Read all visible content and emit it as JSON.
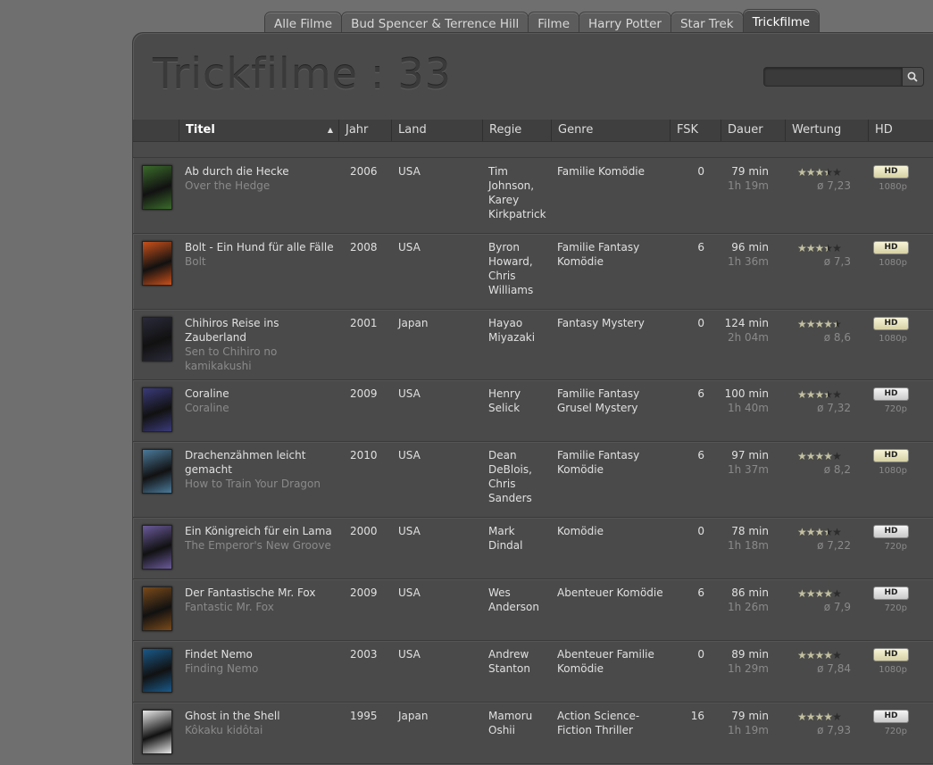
{
  "tabs": [
    {
      "label": "Alle Filme",
      "active": false
    },
    {
      "label": "Bud Spencer & Terrence Hill",
      "active": false
    },
    {
      "label": "Filme",
      "active": false
    },
    {
      "label": "Harry Potter",
      "active": false
    },
    {
      "label": "Star Trek",
      "active": false
    },
    {
      "label": "Trickfilme",
      "active": true
    }
  ],
  "page": {
    "title": "Trickfilme",
    "separator": ":",
    "count": "33"
  },
  "search": {
    "placeholder": "",
    "value": ""
  },
  "columns": [
    {
      "key": "poster",
      "label": ""
    },
    {
      "key": "titel",
      "label": "Titel",
      "sorted": true
    },
    {
      "key": "jahr",
      "label": "Jahr"
    },
    {
      "key": "land",
      "label": "Land"
    },
    {
      "key": "regie",
      "label": "Regie"
    },
    {
      "key": "genre",
      "label": "Genre"
    },
    {
      "key": "fsk",
      "label": "FSK"
    },
    {
      "key": "dauer",
      "label": "Dauer"
    },
    {
      "key": "wertung",
      "label": "Wertung"
    },
    {
      "key": "hd",
      "label": "HD"
    }
  ],
  "colors": {
    "poster": [
      "#3a6b2a",
      "#c8501a",
      "#2a2a3a",
      "#3a3a7a",
      "#4a7a9a",
      "#6a5a9a",
      "#7a4a1a",
      "#1a5a8a",
      "#e8e8e8"
    ]
  },
  "movies": [
    {
      "title": "Ab durch die Hecke",
      "original": "Over the Hedge",
      "year": "2006",
      "country": "USA",
      "director": [
        "Tim",
        "Johnson,",
        "Karey",
        "Kirkpatrick"
      ],
      "genre": [
        "Familie Komödie"
      ],
      "fsk": "0",
      "minutes": "79 min",
      "hours": "1h 19m",
      "stars": 3.5,
      "rating": "ø 7,23",
      "hd": "HD",
      "hd_style": "gold",
      "res": "1080p"
    },
    {
      "title": "Bolt - Ein Hund für alle Fälle",
      "original": "Bolt",
      "year": "2008",
      "country": "USA",
      "director": [
        "Byron",
        "Howard,",
        "Chris",
        "Williams"
      ],
      "genre": [
        "Familie Fantasy",
        "Komödie"
      ],
      "fsk": "6",
      "minutes": "96 min",
      "hours": "1h 36m",
      "stars": 3.5,
      "rating": "ø 7,3",
      "hd": "HD",
      "hd_style": "gold",
      "res": "1080p"
    },
    {
      "title": "Chihiros Reise ins Zauberland",
      "title_lines": [
        "Chihiros Reise ins",
        "Zauberland"
      ],
      "original_lines": [
        "Sen to Chihiro no",
        "kamikakushi"
      ],
      "year": "2001",
      "country": "Japan",
      "director": [
        "Hayao",
        "Miyazaki"
      ],
      "genre": [
        "Fantasy Mystery"
      ],
      "fsk": "0",
      "minutes": "124 min",
      "hours": "2h 04m",
      "stars": 4.5,
      "rating": "ø 8,6",
      "hd": "HD",
      "hd_style": "gold",
      "res": "1080p"
    },
    {
      "title": "Coraline",
      "original": "Coraline",
      "year": "2009",
      "country": "USA",
      "director": [
        "Henry",
        "Selick"
      ],
      "genre": [
        "Familie Fantasy",
        "Grusel Mystery"
      ],
      "fsk": "6",
      "minutes": "100 min",
      "hours": "1h 40m",
      "stars": 3.5,
      "rating": "ø 7,32",
      "hd": "HD",
      "hd_style": "silver",
      "res": "720p"
    },
    {
      "title_lines": [
        "Drachenzähmen leicht",
        "gemacht"
      ],
      "original": "How to Train Your Dragon",
      "year": "2010",
      "country": "USA",
      "director": [
        "Dean",
        "DeBlois,",
        "Chris",
        "Sanders"
      ],
      "genre": [
        "Familie Fantasy",
        "Komödie"
      ],
      "fsk": "6",
      "minutes": "97 min",
      "hours": "1h 37m",
      "stars": 4,
      "rating": "ø 8,2",
      "hd": "HD",
      "hd_style": "gold",
      "res": "1080p"
    },
    {
      "title": "Ein Königreich für ein Lama",
      "original": "The Emperor's New Groove",
      "year": "2000",
      "country": "USA",
      "director": [
        "Mark",
        "Dindal"
      ],
      "genre": [
        "Komödie"
      ],
      "fsk": "0",
      "minutes": "78 min",
      "hours": "1h 18m",
      "stars": 3.5,
      "rating": "ø 7,22",
      "hd": "HD",
      "hd_style": "silver",
      "res": "720p"
    },
    {
      "title": "Der Fantastische Mr. Fox",
      "original": "Fantastic Mr. Fox",
      "year": "2009",
      "country": "USA",
      "director": [
        "Wes",
        "Anderson"
      ],
      "genre": [
        "Abenteuer Komödie"
      ],
      "fsk": "6",
      "minutes": "86 min",
      "hours": "1h 26m",
      "stars": 4,
      "rating": "ø 7,9",
      "hd": "HD",
      "hd_style": "silver",
      "res": "720p"
    },
    {
      "title": "Findet Nemo",
      "original": "Finding Nemo",
      "year": "2003",
      "country": "USA",
      "director": [
        "Andrew",
        "Stanton"
      ],
      "genre": [
        "Abenteuer Familie",
        "Komödie"
      ],
      "fsk": "0",
      "minutes": "89 min",
      "hours": "1h 29m",
      "stars": 4,
      "rating": "ø 7,84",
      "hd": "HD",
      "hd_style": "gold",
      "res": "1080p"
    },
    {
      "title": "Ghost in the Shell",
      "original": "Kôkaku kidôtai",
      "year": "1995",
      "country": "Japan",
      "director": [
        "Mamoru",
        "Oshii"
      ],
      "genre": [
        "Action Science-",
        "Fiction Thriller"
      ],
      "fsk": "16",
      "minutes": "79 min",
      "hours": "1h 19m",
      "stars": 4,
      "rating": "ø 7,93",
      "hd": "HD",
      "hd_style": "silver",
      "res": "720p"
    }
  ]
}
